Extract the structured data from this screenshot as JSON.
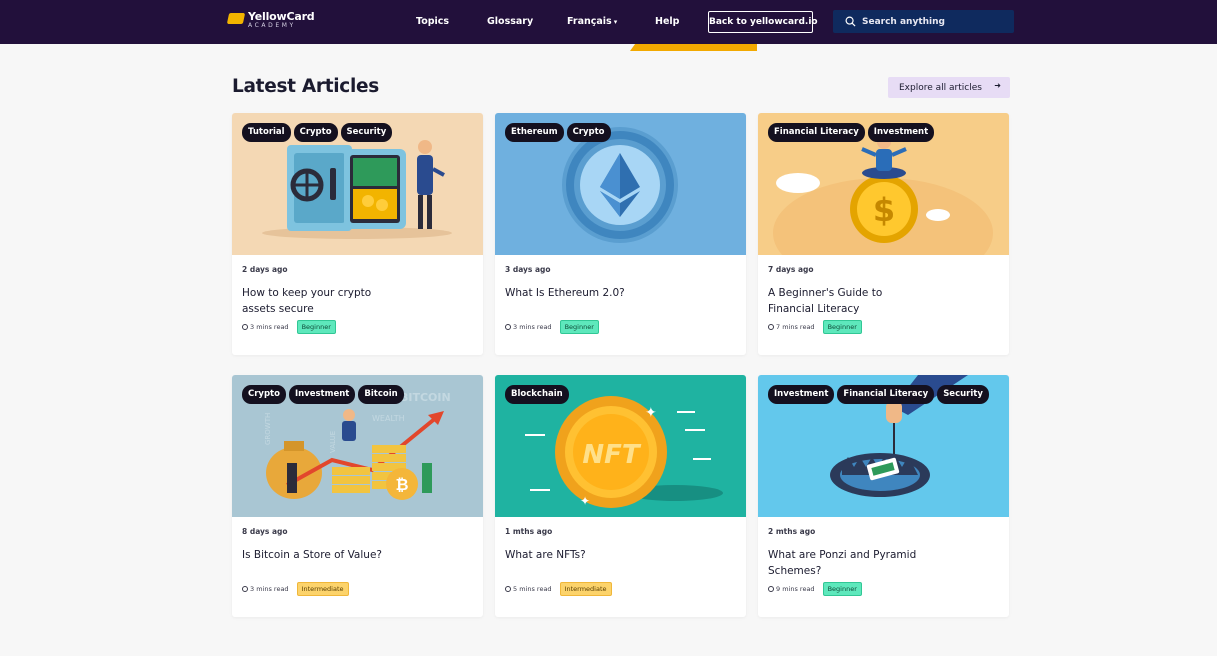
{
  "brand": {
    "name_part1": "Yellow",
    "name_part2": "Card",
    "subtitle": "ACADEMY",
    "accent": "#f2b400"
  },
  "nav": {
    "topics": "Topics",
    "glossary": "Glossary",
    "language": "Français",
    "help": "Help",
    "back_button": "Back to yellowcard.io",
    "search_placeholder": "Search anything",
    "background": "#22103b"
  },
  "section": {
    "title": "Latest Articles",
    "explore_button": "Explore all articles"
  },
  "articles": [
    {
      "tags": [
        "Tutorial",
        "Crypto",
        "Security"
      ],
      "date": "2 days ago",
      "title": "How to keep your crypto assets secure",
      "read_time": "3 mins read",
      "level": "Beginner",
      "image": "vault-illustration",
      "image_bg": "#f4d8b4"
    },
    {
      "tags": [
        "Ethereum",
        "Crypto"
      ],
      "date": "3 days ago",
      "title": "What Is Ethereum 2.0?",
      "read_time": "3 mins read",
      "level": "Beginner",
      "image": "ethereum-coin-illustration",
      "image_bg": "#6fb0df"
    },
    {
      "tags": [
        "Financial Literacy",
        "Investment"
      ],
      "date": "7 days ago",
      "title": "A Beginner's Guide to Financial Literacy",
      "read_time": "7 mins read",
      "level": "Beginner",
      "image": "dollar-coin-illustration",
      "image_bg": "#f7cd88"
    },
    {
      "tags": [
        "Crypto",
        "Investment",
        "Bitcoin"
      ],
      "date": "8 days ago",
      "title": "Is Bitcoin a Store of Value?",
      "read_time": "3 mins read",
      "level": "Intermediate",
      "image": "bitcoin-growth-illustration",
      "image_bg": "#a9c6d3"
    },
    {
      "tags": [
        "Blockchain"
      ],
      "date": "1 mths ago",
      "title": "What are NFTs?",
      "read_time": "5 mins read",
      "level": "Intermediate",
      "image": "nft-coin-illustration",
      "image_bg": "#1fb3a1"
    },
    {
      "tags": [
        "Investment",
        "Financial Literacy",
        "Security"
      ],
      "date": "2 mths ago",
      "title": "What are Ponzi and Pyramid Schemes?",
      "read_time": "9 mins read",
      "level": "Beginner",
      "image": "money-trap-illustration",
      "image_bg": "#63c8ec"
    }
  ],
  "image_text": {
    "bitcoin": "BITCOIN",
    "wealth": "WEALTH",
    "value": "VALUE",
    "growth": "GROWTH",
    "nft": "NFT"
  }
}
